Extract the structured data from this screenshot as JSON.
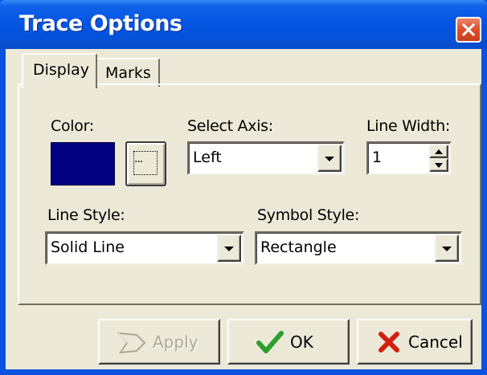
{
  "window": {
    "title": "Trace Options",
    "close_icon": "close-icon"
  },
  "tabs": [
    {
      "label": "Display",
      "active": true
    },
    {
      "label": "Marks",
      "active": false
    }
  ],
  "display": {
    "color": {
      "label": "Color:",
      "value": "#000080",
      "picker_label": "..."
    },
    "select_axis": {
      "label": "Select Axis:",
      "value": "Left"
    },
    "line_width": {
      "label": "Line Width:",
      "value": "1"
    },
    "line_style": {
      "label": "Line Style:",
      "value": "Solid Line"
    },
    "symbol_style": {
      "label": "Symbol Style:",
      "value": "Rectangle"
    }
  },
  "buttons": {
    "apply": {
      "label": "Apply",
      "enabled": false,
      "icon": "apply-pen-icon"
    },
    "ok": {
      "label": "OK",
      "icon": "checkmark-icon",
      "icon_color": "#2E9E2E"
    },
    "cancel": {
      "label": "Cancel",
      "icon": "x-icon",
      "icon_color": "#D02010"
    }
  },
  "colors": {
    "titlebar": "#0555E3",
    "dialog_bg": "#ECE9D8",
    "swatch": "#000080"
  }
}
